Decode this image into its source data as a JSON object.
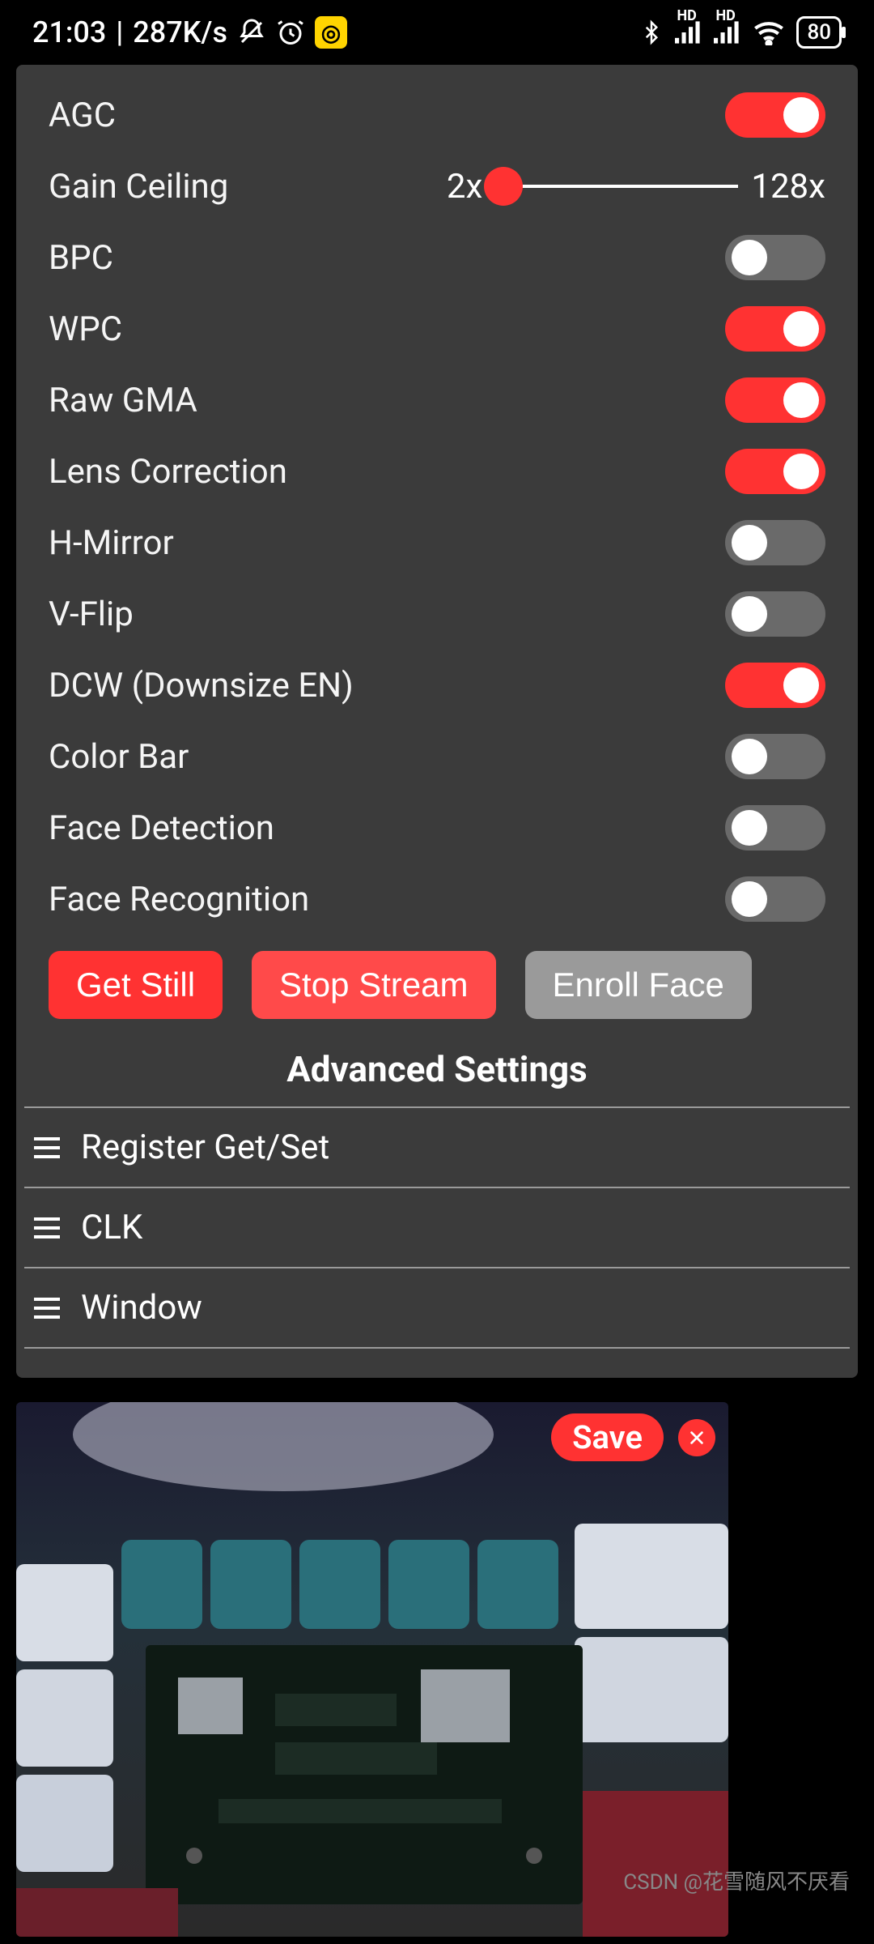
{
  "status": {
    "time": "21:03",
    "speed": "287K/s",
    "battery": "80"
  },
  "settings": [
    {
      "key": "agc",
      "label": "AGC",
      "type": "toggle",
      "value": true
    },
    {
      "key": "gain",
      "label": "Gain Ceiling",
      "type": "slider",
      "min_label": "2x",
      "max_label": "128x"
    },
    {
      "key": "bpc",
      "label": "BPC",
      "type": "toggle",
      "value": false
    },
    {
      "key": "wpc",
      "label": "WPC",
      "type": "toggle",
      "value": true
    },
    {
      "key": "rawgma",
      "label": "Raw GMA",
      "type": "toggle",
      "value": true
    },
    {
      "key": "lenscorr",
      "label": "Lens Correction",
      "type": "toggle",
      "value": true
    },
    {
      "key": "hmirror",
      "label": "H-Mirror",
      "type": "toggle",
      "value": false
    },
    {
      "key": "vflip",
      "label": "V-Flip",
      "type": "toggle",
      "value": false
    },
    {
      "key": "dcw",
      "label": "DCW (Downsize EN)",
      "type": "toggle",
      "value": true
    },
    {
      "key": "colorbar",
      "label": "Color Bar",
      "type": "toggle",
      "value": false
    },
    {
      "key": "facedet",
      "label": "Face Detection",
      "type": "toggle",
      "value": false
    },
    {
      "key": "facerec",
      "label": "Face Recognition",
      "type": "toggle",
      "value": false
    }
  ],
  "buttons": {
    "get_still": "Get Still",
    "stop_stream": "Stop Stream",
    "enroll_face": "Enroll Face"
  },
  "advanced": {
    "heading": "Advanced Settings",
    "items": [
      {
        "key": "register",
        "label": "Register Get/Set"
      },
      {
        "key": "clk",
        "label": "CLK"
      },
      {
        "key": "window",
        "label": "Window"
      }
    ]
  },
  "preview": {
    "save_label": "Save"
  },
  "watermark": "CSDN @花雪随风不厌看"
}
